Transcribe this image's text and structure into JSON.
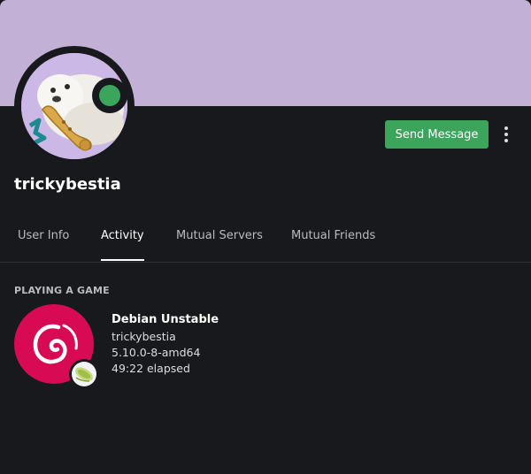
{
  "colors": {
    "banner": "#c3b0d6",
    "card_background": "#18191c",
    "status_online": "#3ba55c",
    "button": "#3ba55c",
    "debian_red": "#d70a53"
  },
  "profile": {
    "username": "trickybestia",
    "status": "online",
    "avatar_icon": "seal-saxophone-avatar-icon"
  },
  "actions": {
    "send_message_label": "Send Message",
    "more_icon": "vertical-dots-icon"
  },
  "tabs": [
    {
      "label": "User Info",
      "active": false
    },
    {
      "label": "Activity",
      "active": true
    },
    {
      "label": "Mutual Servers",
      "active": false
    },
    {
      "label": "Mutual Friends",
      "active": false
    }
  ],
  "activity": {
    "section_title": "PLAYING A GAME",
    "game_icon": "debian-swirl-icon",
    "badge_icon": "corn-icon",
    "name": "Debian Unstable",
    "details": "trickybestia",
    "state": "5.10.0-8-amd64",
    "elapsed": "49:22 elapsed"
  }
}
